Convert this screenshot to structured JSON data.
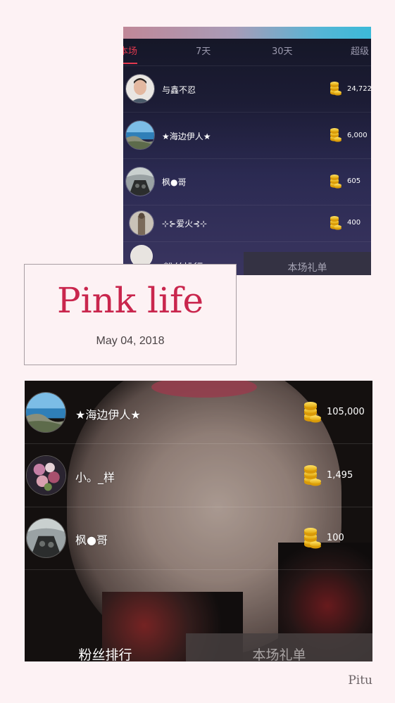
{
  "top_panel": {
    "tabs": [
      {
        "label": "本场",
        "active": true
      },
      {
        "label": "7天",
        "active": false
      },
      {
        "label": "30天",
        "active": false
      },
      {
        "label": "超级",
        "active": false
      }
    ],
    "rows": [
      {
        "name": "与鑫不忍",
        "amount": "24,722",
        "avatar": "portrait"
      },
      {
        "name": "★海边伊人★",
        "amount": "6,000",
        "avatar": "seaside"
      },
      {
        "name": "枫●哥",
        "amount": "605",
        "avatar": "cockpit"
      },
      {
        "name": "⊹⊱爱火⊰⊹",
        "amount": "400",
        "avatar": "figure"
      }
    ],
    "bottom_left": "粉丝排行",
    "bottom_right": "本场礼单"
  },
  "title_card": {
    "title": "Pink life",
    "date": "May 04, 2018"
  },
  "bottom_panel": {
    "rows": [
      {
        "name": "★海边伊人★",
        "amount": "105,000",
        "avatar": "seaside"
      },
      {
        "name": "小。_样",
        "amount": "1,495",
        "avatar": "flowers"
      },
      {
        "name": "枫●哥",
        "amount": "100",
        "avatar": "cockpit"
      }
    ],
    "bottom_left": "粉丝排行",
    "bottom_right": "本场礼单"
  },
  "watermark": "Pitu",
  "colors": {
    "accent_red": "#e2394f",
    "title_pink": "#c9264d",
    "coin_gold": "#f2c21a"
  }
}
